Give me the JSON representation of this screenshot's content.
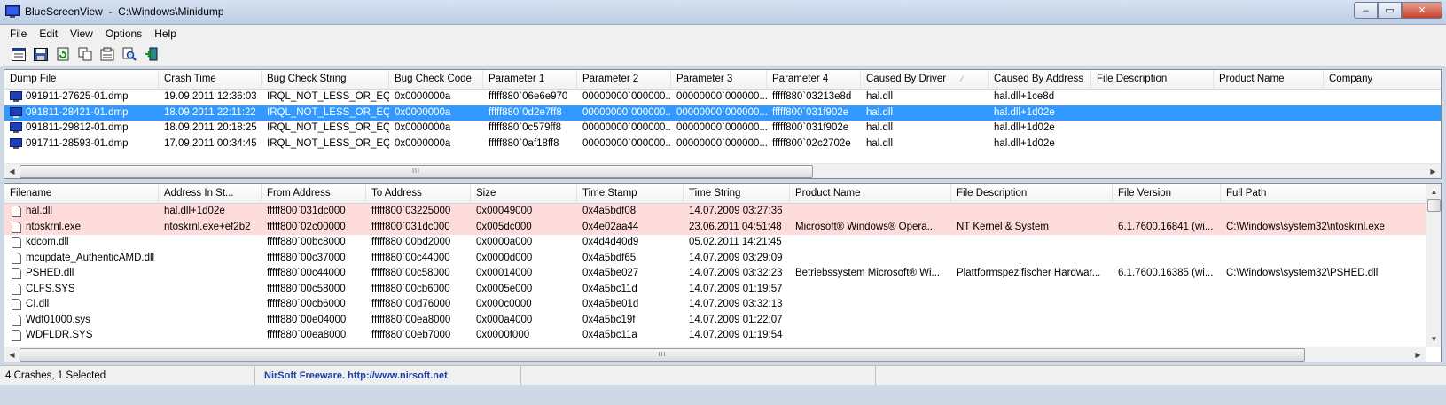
{
  "window": {
    "title": "BlueScreenView  -  C:\\Windows\\Minidump",
    "minimize_glyph": "–",
    "maximize_glyph": "▭",
    "close_glyph": "✕"
  },
  "menu": [
    "File",
    "Edit",
    "View",
    "Options",
    "Help"
  ],
  "toolbar": {
    "icons": [
      "html-report-icon",
      "save-icon",
      "refresh-icon",
      "copy-icon",
      "properties-icon",
      "find-icon",
      "exit-icon"
    ]
  },
  "crash_list": {
    "columns": [
      "Dump File",
      "Crash Time",
      "Bug Check String",
      "Bug Check Code",
      "Parameter 1",
      "Parameter 2",
      "Parameter 3",
      "Parameter 4",
      "Caused By Driver",
      "Caused By Address",
      "File Description",
      "Product Name",
      "Company"
    ],
    "sort_glyph": "∕",
    "rows": [
      [
        "091911-27625-01.dmp",
        "19.09.2011 12:36:03",
        "IRQL_NOT_LESS_OR_EQ...",
        "0x0000000a",
        "fffff880`06e6e970",
        "00000000`000000...",
        "00000000`000000...",
        "fffff880`03213e8d",
        "hal.dll",
        "hal.dll+1ce8d",
        "",
        "",
        ""
      ],
      [
        "091811-28421-01.dmp",
        "18.09.2011 22:11:22",
        "IRQL_NOT_LESS_OR_EQ...",
        "0x0000000a",
        "fffff880`0d2e7ff8",
        "00000000`000000...",
        "00000000`000000...",
        "fffff800`031f902e",
        "hal.dll",
        "hal.dll+1d02e",
        "",
        "",
        ""
      ],
      [
        "091811-29812-01.dmp",
        "18.09.2011 20:18:25",
        "IRQL_NOT_LESS_OR_EQ...",
        "0x0000000a",
        "fffff880`0c579ff8",
        "00000000`000000...",
        "00000000`000000...",
        "fffff800`031f902e",
        "hal.dll",
        "hal.dll+1d02e",
        "",
        "",
        ""
      ],
      [
        "091711-28593-01.dmp",
        "17.09.2011 00:34:45",
        "IRQL_NOT_LESS_OR_EQ...",
        "0x0000000a",
        "fffff880`0af18ff8",
        "00000000`000000...",
        "00000000`000000...",
        "fffff800`02c2702e",
        "hal.dll",
        "hal.dll+1d02e",
        "",
        "",
        ""
      ]
    ],
    "selected_row": 1
  },
  "driver_list": {
    "columns": [
      "Filename",
      "Address In St...",
      "From Address",
      "To Address",
      "Size",
      "Time Stamp",
      "Time String",
      "Product Name",
      "File Description",
      "File Version",
      "Full Path"
    ],
    "rows": [
      [
        "hal.dll",
        "hal.dll+1d02e",
        "fffff800`031dc000",
        "fffff800`03225000",
        "0x00049000",
        "0x4a5bdf08",
        "14.07.2009 03:27:36",
        "",
        "",
        "",
        ""
      ],
      [
        "ntoskrnl.exe",
        "ntoskrnl.exe+ef2b2",
        "fffff800`02c00000",
        "fffff800`031dc000",
        "0x005dc000",
        "0x4e02aa44",
        "23.06.2011 04:51:48",
        "Microsoft® Windows® Opera...",
        "NT Kernel & System",
        "6.1.7600.16841 (wi...",
        "C:\\Windows\\system32\\ntoskrnl.exe"
      ],
      [
        "kdcom.dll",
        "",
        "fffff880`00bc8000",
        "fffff880`00bd2000",
        "0x0000a000",
        "0x4d4d40d9",
        "05.02.2011 14:21:45",
        "",
        "",
        "",
        ""
      ],
      [
        "mcupdate_AuthenticAMD.dll",
        "",
        "fffff880`00c37000",
        "fffff880`00c44000",
        "0x0000d000",
        "0x4a5bdf65",
        "14.07.2009 03:29:09",
        "",
        "",
        "",
        ""
      ],
      [
        "PSHED.dll",
        "",
        "fffff880`00c44000",
        "fffff880`00c58000",
        "0x00014000",
        "0x4a5be027",
        "14.07.2009 03:32:23",
        "Betriebssystem Microsoft® Wi...",
        "Plattformspezifischer Hardwar...",
        "6.1.7600.16385 (wi...",
        "C:\\Windows\\system32\\PSHED.dll"
      ],
      [
        "CLFS.SYS",
        "",
        "fffff880`00c58000",
        "fffff880`00cb6000",
        "0x0005e000",
        "0x4a5bc11d",
        "14.07.2009 01:19:57",
        "",
        "",
        "",
        ""
      ],
      [
        "CI.dll",
        "",
        "fffff880`00cb6000",
        "fffff880`00d76000",
        "0x000c0000",
        "0x4a5be01d",
        "14.07.2009 03:32:13",
        "",
        "",
        "",
        ""
      ],
      [
        "Wdf01000.sys",
        "",
        "fffff880`00e04000",
        "fffff880`00ea8000",
        "0x000a4000",
        "0x4a5bc19f",
        "14.07.2009 01:22:07",
        "",
        "",
        "",
        ""
      ],
      [
        "WDFLDR.SYS",
        "",
        "fffff880`00ea8000",
        "fffff880`00eb7000",
        "0x0000f000",
        "0x4a5bc11a",
        "14.07.2009 01:19:54",
        "",
        "",
        "",
        ""
      ]
    ],
    "highlighted_rows": [
      0,
      1
    ]
  },
  "scrollbars": {
    "left_arrow": "◀",
    "right_arrow": "▶",
    "up_arrow": "▲",
    "down_arrow": "▼",
    "grip": "III"
  },
  "status": {
    "summary": "4 Crashes, 1 Selected",
    "credit": "NirSoft Freeware.  http://www.nirsoft.net"
  },
  "colors": {
    "selected_row": "#3399ff",
    "highlight_row": "#ffdcdc",
    "link": "#1b3fa8"
  }
}
